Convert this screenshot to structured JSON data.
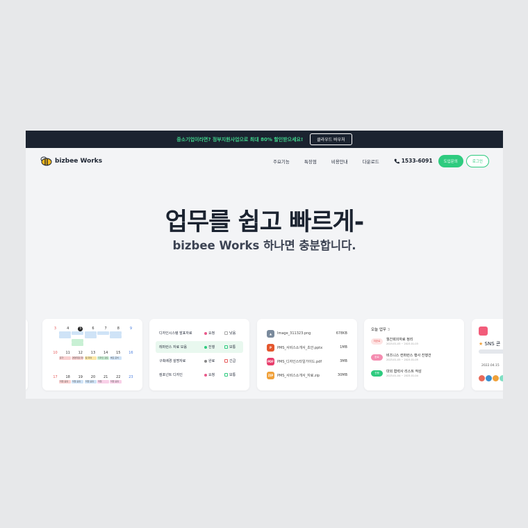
{
  "banner": {
    "text": "중소기업이라면? 정부지원사업으로 최대 80% 할인받으세요!",
    "button": "클라우드 바우처"
  },
  "nav": {
    "logo": "bizbee Works",
    "items": [
      "주요기능",
      "특장점",
      "비용안내",
      "다운로드"
    ],
    "phone": "1533-6091",
    "cta": "도입문의",
    "login": "로그인"
  },
  "hero": {
    "title": "업무를 쉽고 빠르게-",
    "subtitle": "bizbee Works 하나면 충분합니다."
  },
  "calendar": {
    "weeks": [
      [
        "3",
        "4",
        "5",
        "6",
        "7",
        "8",
        "9"
      ],
      [
        "10",
        "11",
        "12",
        "13",
        "14",
        "15",
        "16"
      ],
      [
        "17",
        "18",
        "19",
        "20",
        "21",
        "22",
        "23"
      ]
    ],
    "events": [
      "휴가",
      "경영지원 회의",
      "팀 회의",
      "디자인 검토",
      "배포 준비",
      "작업 공유",
      "작업 공유",
      "작업 공유",
      "작업",
      "작업 공유"
    ]
  },
  "tasks": [
    {
      "name": "디자인시스템 발표자료",
      "status": "요청",
      "priority": "낮음"
    },
    {
      "name": "레퍼런스 자료 모음",
      "status": "진행",
      "priority": "보통"
    },
    {
      "name": "구축배경 설명자료",
      "status": "완료",
      "priority": "긴급"
    },
    {
      "name": "컴포넌트 디자인",
      "status": "요청",
      "priority": "보통"
    }
  ],
  "files": [
    {
      "name": "Image_311323.png",
      "size": "678KB",
      "icon": "image-icon",
      "color": "#7a8a9c"
    },
    {
      "name": "PMS_서비스소개서_초안.pptx",
      "size": "1MB",
      "icon": "pptx-icon",
      "color": "#e4572e"
    },
    {
      "name": "PMS_디자인스타일가이드.pdf",
      "size": "3MB",
      "icon": "pdf-icon",
      "color": "#e83e6c"
    },
    {
      "name": "PMS_서비스소개서_자료.zip",
      "size": "30MB",
      "icon": "zip-icon",
      "color": "#f0a13a"
    }
  ],
  "todo": {
    "title": "오늘 업무",
    "count": "3",
    "items": [
      {
        "tag": "미완료",
        "name": "월간회의자료 정리",
        "date": "2023-01-03 ~ 2023-01-03"
      },
      {
        "tag": "완료",
        "name": "비즈니스 컨퍼런스 행사 진행건",
        "date": "2023-01-03 ~ 2023-01-05"
      },
      {
        "tag": "진행",
        "name": "대외 협력사 리스트 작성",
        "date": "2023-01-04 ~ 2023-01-04"
      }
    ]
  },
  "sns": {
    "title": "SNS 콘",
    "date": "2022.04.15"
  },
  "colors": {
    "accent": "#2ecb7f",
    "dark": "#1b2330"
  }
}
